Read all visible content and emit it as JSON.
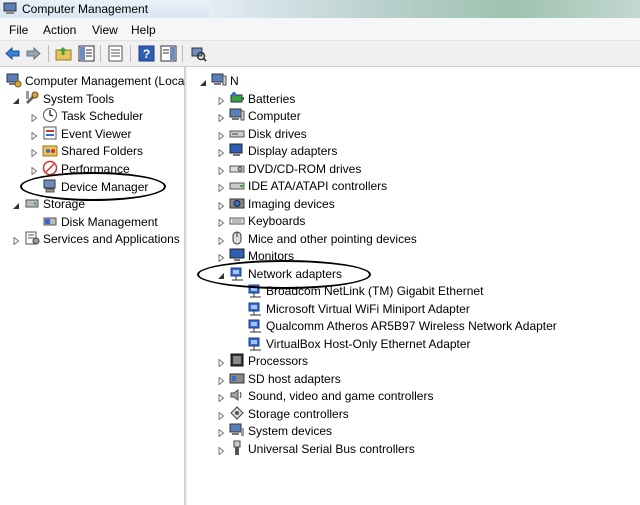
{
  "window": {
    "title": "Computer Management"
  },
  "menu": [
    "File",
    "Action",
    "View",
    "Help"
  ],
  "toolbar": [
    {
      "name": "back-arrow-icon"
    },
    {
      "name": "forward-arrow-icon"
    },
    {
      "name": "up-folder-icon"
    },
    {
      "name": "show-hide-console-tree-icon"
    },
    {
      "name": "properties-icon"
    },
    {
      "name": "help-icon"
    },
    {
      "name": "show-hide-action-pane-icon"
    },
    {
      "name": "scan-hardware-icon"
    }
  ],
  "left_tree": [
    {
      "label": "Computer Management (Local",
      "level": 0,
      "expand": "none",
      "icon": "computer-management-icon"
    },
    {
      "label": "System Tools",
      "level": 1,
      "expand": "open",
      "icon": "system-tools-icon"
    },
    {
      "label": "Task Scheduler",
      "level": 2,
      "expand": "closed",
      "icon": "task-scheduler-icon"
    },
    {
      "label": "Event Viewer",
      "level": 2,
      "expand": "closed",
      "icon": "event-viewer-icon"
    },
    {
      "label": "Shared Folders",
      "level": 2,
      "expand": "closed",
      "icon": "shared-folders-icon"
    },
    {
      "label": "Performance",
      "level": 2,
      "expand": "closed",
      "icon": "performance-icon"
    },
    {
      "label": "Device Manager",
      "level": 2,
      "expand": "none",
      "icon": "device-manager-icon"
    },
    {
      "label": "Storage",
      "level": 1,
      "expand": "open",
      "icon": "storage-icon"
    },
    {
      "label": "Disk Management",
      "level": 2,
      "expand": "none",
      "icon": "disk-management-icon"
    },
    {
      "label": "Services and Applications",
      "level": 1,
      "expand": "closed",
      "icon": "services-icon"
    }
  ],
  "right_tree": [
    {
      "label": "N",
      "level": 0,
      "expand": "open",
      "icon": "computer-icon"
    },
    {
      "label": "Batteries",
      "level": 1,
      "expand": "closed",
      "icon": "battery-icon"
    },
    {
      "label": "Computer",
      "level": 1,
      "expand": "closed",
      "icon": "computer-icon"
    },
    {
      "label": "Disk drives",
      "level": 1,
      "expand": "closed",
      "icon": "disk-drive-icon"
    },
    {
      "label": "Display adapters",
      "level": 1,
      "expand": "closed",
      "icon": "display-adapter-icon"
    },
    {
      "label": "DVD/CD-ROM drives",
      "level": 1,
      "expand": "closed",
      "icon": "dvd-drive-icon"
    },
    {
      "label": "IDE ATA/ATAPI controllers",
      "level": 1,
      "expand": "closed",
      "icon": "ide-controller-icon"
    },
    {
      "label": "Imaging devices",
      "level": 1,
      "expand": "closed",
      "icon": "camera-icon"
    },
    {
      "label": "Keyboards",
      "level": 1,
      "expand": "closed",
      "icon": "keyboard-icon"
    },
    {
      "label": "Mice and other pointing devices",
      "level": 1,
      "expand": "closed",
      "icon": "mouse-icon"
    },
    {
      "label": "Monitors",
      "level": 1,
      "expand": "closed",
      "icon": "monitor-icon"
    },
    {
      "label": "Network adapters",
      "level": 1,
      "expand": "open",
      "icon": "network-adapter-icon"
    },
    {
      "label": "Broadcom NetLink (TM) Gigabit Ethernet",
      "level": 2,
      "expand": "none",
      "icon": "network-adapter-icon"
    },
    {
      "label": "Microsoft Virtual WiFi Miniport Adapter",
      "level": 2,
      "expand": "none",
      "icon": "network-adapter-icon"
    },
    {
      "label": "Qualcomm Atheros AR5B97 Wireless Network Adapter",
      "level": 2,
      "expand": "none",
      "icon": "network-adapter-icon"
    },
    {
      "label": "VirtualBox Host-Only Ethernet Adapter",
      "level": 2,
      "expand": "none",
      "icon": "network-adapter-icon"
    },
    {
      "label": "Processors",
      "level": 1,
      "expand": "closed",
      "icon": "processor-icon"
    },
    {
      "label": "SD host adapters",
      "level": 1,
      "expand": "closed",
      "icon": "sd-card-icon"
    },
    {
      "label": "Sound, video and game controllers",
      "level": 1,
      "expand": "closed",
      "icon": "speaker-icon"
    },
    {
      "label": "Storage controllers",
      "level": 1,
      "expand": "closed",
      "icon": "storage-controller-icon"
    },
    {
      "label": "System devices",
      "level": 1,
      "expand": "closed",
      "icon": "system-device-icon"
    },
    {
      "label": "Universal Serial Bus controllers",
      "level": 1,
      "expand": "closed",
      "icon": "usb-icon"
    }
  ]
}
